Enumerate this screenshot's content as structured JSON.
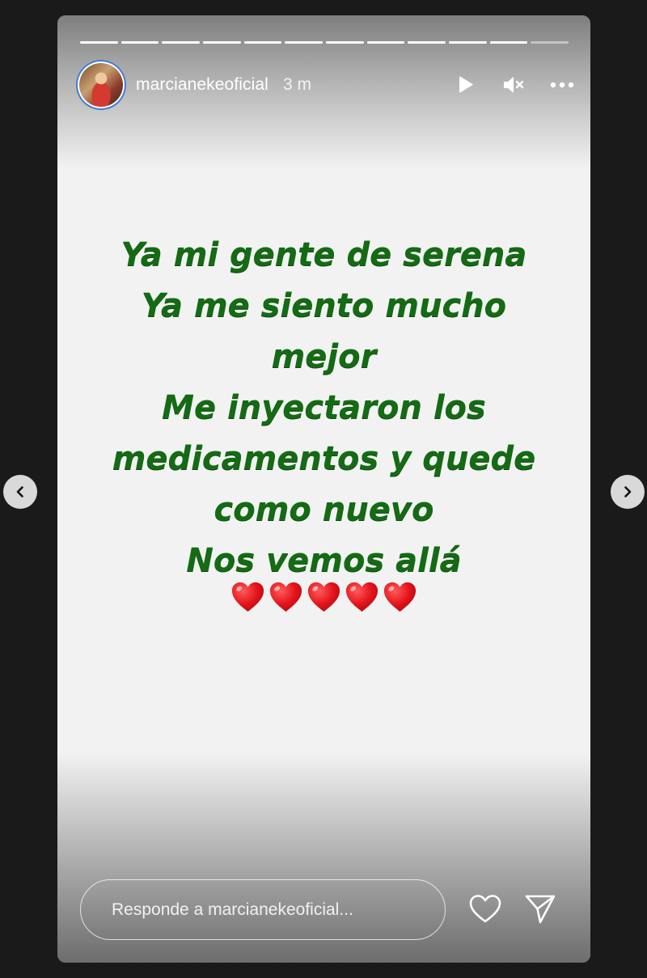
{
  "story": {
    "progress": {
      "total_segments": 12,
      "completed_segments": 11
    },
    "header": {
      "username": "marcianekeoficial",
      "time_ago": "3 m",
      "avatar_icon": "profile-avatar",
      "actions": [
        {
          "name": "play-icon"
        },
        {
          "name": "mute-icon"
        },
        {
          "name": "more-options-icon"
        }
      ]
    },
    "message": {
      "lines": [
        "Ya mi gente de serena",
        "Ya me siento mucho",
        "mejor",
        "Me inyectaron los",
        "medicamentos y quede",
        "como nuevo",
        "Nos vemos allá"
      ],
      "color": "#146b14",
      "emoji_hearts": "❤️❤️❤️❤️❤️"
    },
    "reply": {
      "placeholder": "Responde a marcianekeoficial..."
    },
    "bottom_actions": [
      {
        "name": "heart-icon"
      },
      {
        "name": "send-icon"
      }
    ]
  },
  "navigation": {
    "prev_icon": "chevron-left-icon",
    "next_icon": "chevron-right-icon"
  }
}
